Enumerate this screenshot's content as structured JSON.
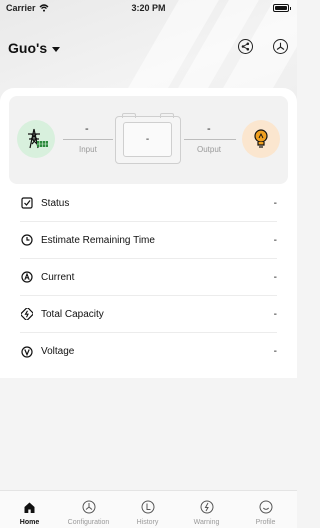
{
  "status_bar": {
    "carrier": "Carrier",
    "time": "3:20 PM"
  },
  "header": {
    "station_name": "Guo's",
    "share_icon": "share-icon",
    "grid_icon": "solar-grid-icon"
  },
  "flow": {
    "input_value": "-",
    "input_label": "Input",
    "device_value": "-",
    "output_value": "-",
    "output_label": "Output",
    "left_node_icon": "power-tower-solar-icon",
    "right_node_icon": "light-bulb-icon",
    "colors": {
      "left_node": "#d8f0dd",
      "right_node": "#fbe6cf",
      "bulb": "#f0a020",
      "tower": "#2c8a3c"
    }
  },
  "rows": [
    {
      "label": "Status",
      "value": "-",
      "icon": "checkbox-icon"
    },
    {
      "label": "Estimate Remaining Time",
      "value": "-",
      "icon": "clock-icon"
    },
    {
      "label": "Current",
      "value": "-",
      "icon": "current-a-icon"
    },
    {
      "label": "Total Capacity",
      "value": "-",
      "icon": "battery-charge-icon"
    },
    {
      "label": "Voltage",
      "value": "-",
      "icon": "voltage-v-icon"
    }
  ],
  "tabs": [
    {
      "label": "Home",
      "icon": "home-icon",
      "active": true
    },
    {
      "label": "Configuration",
      "icon": "configuration-icon",
      "active": false
    },
    {
      "label": "History",
      "icon": "history-icon",
      "active": false
    },
    {
      "label": "Warning",
      "icon": "warning-icon",
      "active": false
    },
    {
      "label": "Profile",
      "icon": "profile-icon",
      "active": false
    }
  ]
}
